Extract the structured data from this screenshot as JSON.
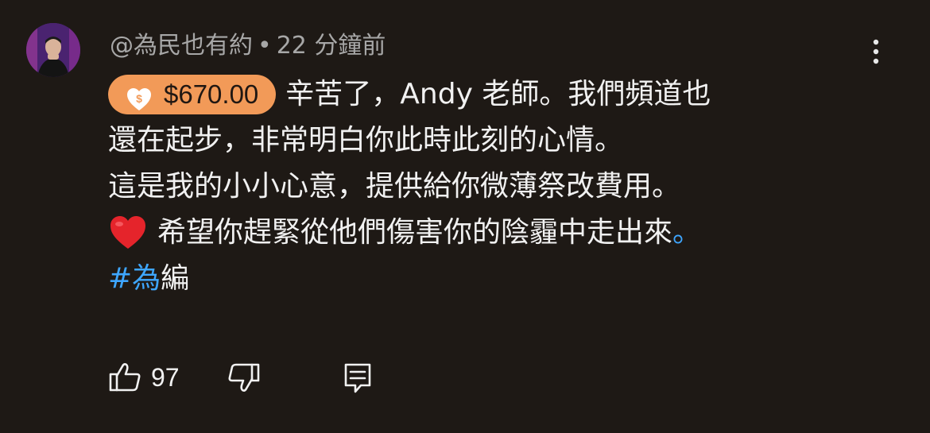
{
  "comment": {
    "author": "@為民也有約",
    "separator": "•",
    "time_ago": "22 分鐘前",
    "superchat_amount": "$670.00",
    "lines": [
      "辛苦了，Andy 老師。我們頻道也",
      "還在起步，非常明白你此時此刻的心情。",
      "這是我的小小心意，提供給你微薄祭改費用。",
      "希望你趕緊從他們傷害你的陰霾中走出來",
      "。"
    ],
    "hashtag": "#為",
    "after_hashtag": "編",
    "like_count": "97"
  },
  "icons": {
    "avatar": "user-avatar",
    "menu": "more-vert-icon",
    "superchat": "heart-dollar-badge-icon",
    "emoji": "red-heart-emoji",
    "like": "thumb-up-icon",
    "dislike": "thumb-down-icon",
    "reply": "reply-comment-icon"
  },
  "colors": {
    "background": "#1e1915",
    "superchat": "#f29a58",
    "link": "#3ea6ff",
    "meta_text": "#a7a7a7"
  }
}
